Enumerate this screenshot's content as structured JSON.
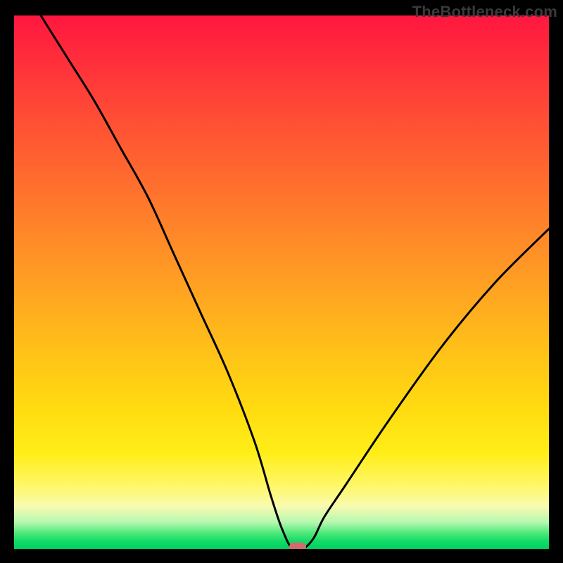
{
  "watermark": "TheBottleneck.com",
  "chart_data": {
    "type": "line",
    "title": "",
    "xlabel": "",
    "ylabel": "",
    "xlim": [
      0,
      100
    ],
    "ylim": [
      0,
      100
    ],
    "grid": false,
    "legend": false,
    "series": [
      {
        "name": "bottleneck-curve",
        "x": [
          5,
          10,
          15,
          20,
          25,
          30,
          35,
          40,
          45,
          48,
          50,
          52,
          54,
          56,
          58,
          62,
          70,
          80,
          90,
          100
        ],
        "values": [
          100,
          92,
          84,
          75,
          66,
          55,
          44,
          33,
          20,
          10,
          4,
          0,
          0,
          2,
          6,
          12,
          24,
          38,
          50,
          60
        ]
      }
    ],
    "marker": {
      "x": 53,
      "y": 0,
      "color": "#d46a6a"
    },
    "background_gradient": {
      "top": "#ff173f",
      "mid": "#ffdc10",
      "bottom": "#00d060"
    }
  }
}
